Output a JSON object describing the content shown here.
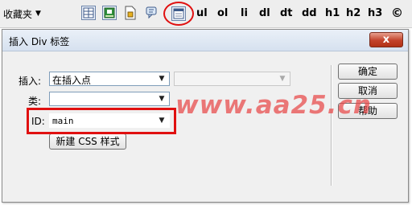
{
  "toolbar": {
    "favorites_label": "收藏夹",
    "tag_buttons": [
      "ul",
      "ol",
      "li",
      "dl",
      "dt",
      "dd",
      "h1",
      "h2",
      "h3",
      "©"
    ],
    "icons": [
      "table-icon",
      "image-icon",
      "document-icon",
      "comment-icon",
      "insert-div-icon"
    ],
    "highlight_color": "#e01010"
  },
  "dialog": {
    "title": "插入 Div 标签",
    "close_symbol": "x",
    "insert_label": "插入:",
    "insert_value": "在插入点",
    "insert_target_value": "",
    "class_label": "类:",
    "class_value": "",
    "id_label": "ID:",
    "id_value": "main",
    "new_css_button": "新建 CSS 样式",
    "ok_button": "确定",
    "cancel_button": "取消",
    "help_button": "帮助"
  },
  "watermark": "www.aa25.cn"
}
